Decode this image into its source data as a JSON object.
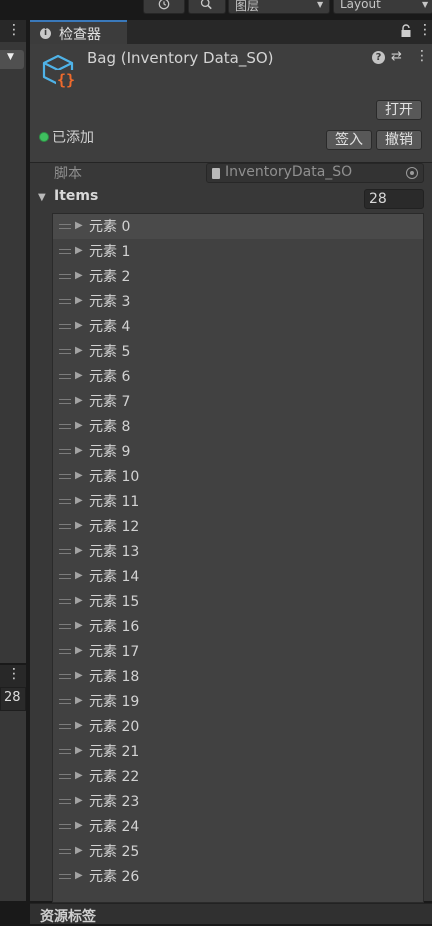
{
  "toolbar": {
    "layers_label": "图层",
    "layout_label": "Layout"
  },
  "left_panel": {
    "lower_value": "28"
  },
  "inspector": {
    "tab_label": "检查器",
    "object_title": "Bag (Inventory Data_SO)",
    "open_button": "打开",
    "status_label": "已添加",
    "checkin_button": "签入",
    "undo_button": "撤销",
    "script_label": "脚本",
    "script_value": "InventoryData_SO",
    "items_label": "Items",
    "items_count": "28",
    "elements": [
      "元素 0",
      "元素 1",
      "元素 2",
      "元素 3",
      "元素 4",
      "元素 5",
      "元素 6",
      "元素 7",
      "元素 8",
      "元素 9",
      "元素 10",
      "元素 11",
      "元素 12",
      "元素 13",
      "元素 14",
      "元素 15",
      "元素 16",
      "元素 17",
      "元素 18",
      "元素 19",
      "元素 20",
      "元素 21",
      "元素 22",
      "元素 23",
      "元素 24",
      "元素 25",
      "元素 26"
    ],
    "bottom_section_label": "资源标签"
  },
  "colors": {
    "tab_accent": "#3a79bb",
    "status_green": "#3fbf5f",
    "icon_blue": "#4fb3e8",
    "icon_orange": "#ef6a2c"
  },
  "icons": [
    "history-icon",
    "search-icon",
    "info-icon",
    "lock-icon",
    "menu-icon",
    "scriptable-object-icon",
    "help-icon",
    "preset-icon",
    "object-picker-icon",
    "file-icon"
  ]
}
